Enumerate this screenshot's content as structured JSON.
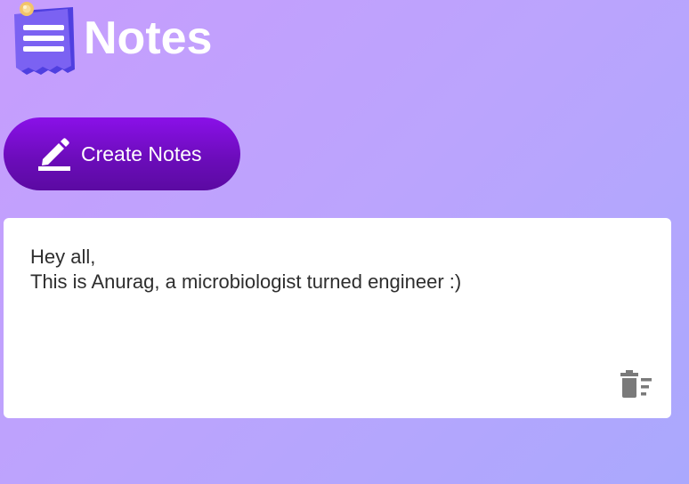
{
  "app": {
    "title": "Notes",
    "logo_icon": "notepad-menu-icon"
  },
  "toolbar": {
    "create_label": "Create Notes",
    "create_icon": "pencil-icon"
  },
  "notes": [
    {
      "text": "Hey all,\nThis is Anurag, a microbiologist turned engineer :)",
      "delete_icon": "delete-sweep-icon"
    }
  ],
  "colors": {
    "background_start": "#c79dfd",
    "background_end": "#aaa8fd",
    "button": "#7a0ed0",
    "card": "#ffffff",
    "text": "#2e2e2e",
    "icon_gray": "#7a7a7a"
  }
}
